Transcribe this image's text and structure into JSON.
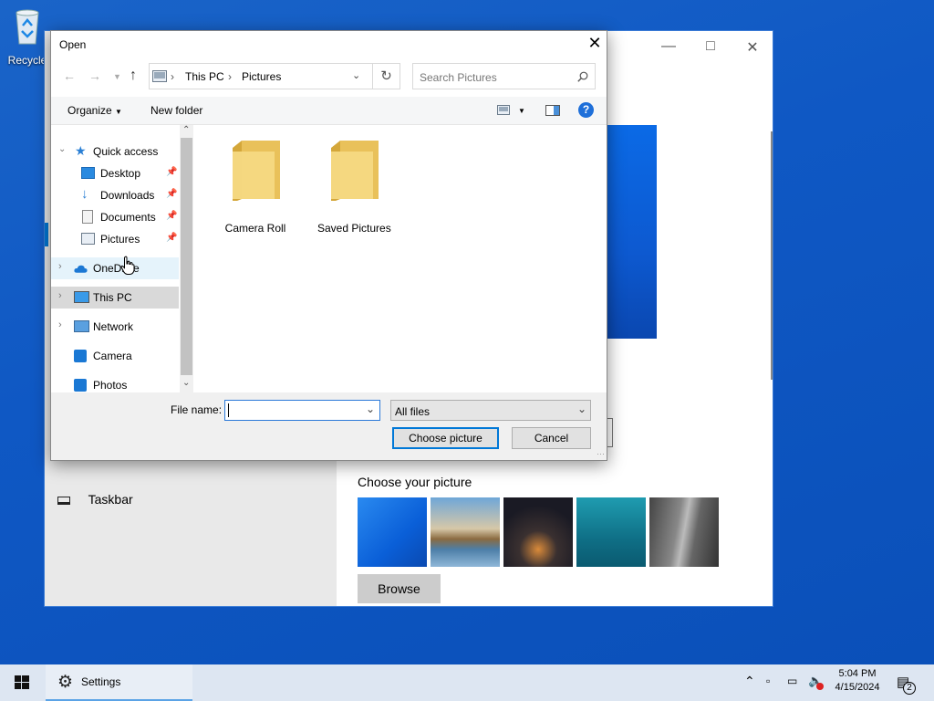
{
  "desktop": {
    "recycle_label": "Recycle"
  },
  "settings_window": {
    "taskbar_item": "Taskbar",
    "choose_picture_title": "Choose your picture",
    "browse_label": "Browse"
  },
  "dialog": {
    "title": "Open",
    "address": {
      "segments": [
        "This PC",
        "Pictures"
      ]
    },
    "search_placeholder": "Search Pictures",
    "toolbar": {
      "organize": "Organize",
      "new_folder": "New folder",
      "help": "?"
    },
    "nav": {
      "quick_access": "Quick access",
      "desktop": "Desktop",
      "downloads": "Downloads",
      "documents": "Documents",
      "pictures": "Pictures",
      "onedrive": "OneDrive",
      "this_pc": "This PC",
      "network": "Network",
      "camera": "Camera",
      "photos": "Photos"
    },
    "folders": [
      "Camera Roll",
      "Saved Pictures"
    ],
    "file_name_label": "File name:",
    "file_name_value": "",
    "file_type": "All files",
    "choose_button": "Choose picture",
    "cancel_button": "Cancel"
  },
  "taskbar": {
    "app_label": "Settings",
    "time": "5:04 PM",
    "date": "4/15/2024",
    "notification_count": "2"
  },
  "colors": {
    "accent": "#0078d7",
    "desktop": "#0f58c4"
  }
}
